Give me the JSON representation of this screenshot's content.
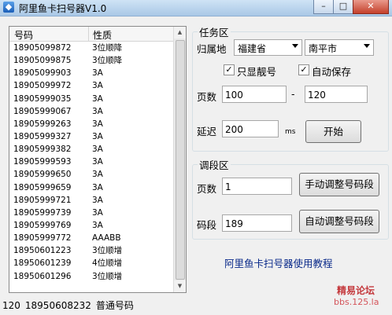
{
  "window": {
    "title": "阿里鱼卡扫号器V1.0",
    "minimize": "–",
    "maximize": "□",
    "close": "✕"
  },
  "list": {
    "headers": [
      "号码",
      "性质"
    ],
    "rows": [
      [
        "18905099872",
        "3位顺降"
      ],
      [
        "18905099875",
        "3位顺降"
      ],
      [
        "18905099903",
        "3A"
      ],
      [
        "18905099972",
        "3A"
      ],
      [
        "18905999035",
        "3A"
      ],
      [
        "18905999067",
        "3A"
      ],
      [
        "18905999263",
        "3A"
      ],
      [
        "18905999327",
        "3A"
      ],
      [
        "18905999382",
        "3A"
      ],
      [
        "18905999593",
        "3A"
      ],
      [
        "18905999650",
        "3A"
      ],
      [
        "18905999659",
        "3A"
      ],
      [
        "18905999721",
        "3A"
      ],
      [
        "18905999739",
        "3A"
      ],
      [
        "18905999769",
        "3A"
      ],
      [
        "18905999772",
        "AAABB"
      ],
      [
        "18950601223",
        "3位顺增"
      ],
      [
        "18950601239",
        "4位顺增"
      ],
      [
        "18950601296",
        "3位顺增"
      ]
    ]
  },
  "status": {
    "count": "120",
    "number": "18950608232",
    "type": "普通号码"
  },
  "task": {
    "legend": "任务区",
    "region_label": "归属地",
    "province": "福建省",
    "city": "南平市",
    "only_good_label": "只显靓号",
    "only_good_checked": true,
    "auto_save_label": "自动保存",
    "auto_save_checked": true,
    "pages_label": "页数",
    "page_from": "100",
    "dash": "-",
    "page_to": "120",
    "delay_label": "延迟",
    "delay_value": "200",
    "delay_unit": "ms",
    "start_button": "开始"
  },
  "adjust": {
    "legend": "调段区",
    "pages_label": "页数",
    "pages_value": "1",
    "manual_button": "手动调整号码段",
    "segment_label": "码段",
    "segment_value": "189",
    "auto_button": "自动调整号码段"
  },
  "tutorial_link": "阿里鱼卡扫号器使用教程",
  "watermark": {
    "line1": "精易论坛",
    "line2": "bbs.125.la"
  }
}
